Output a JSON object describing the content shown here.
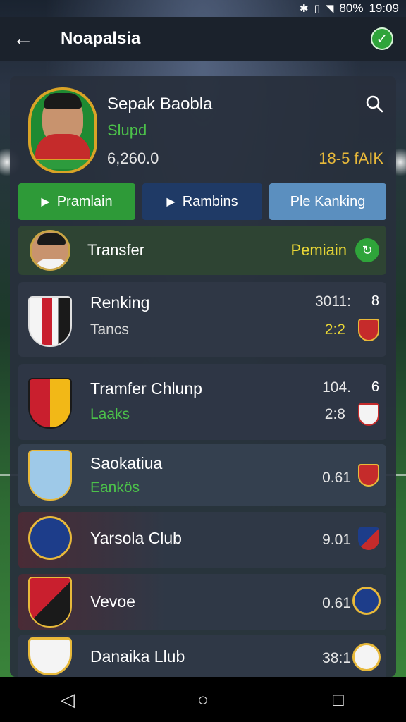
{
  "status_bar": {
    "icons": [
      "bluetooth-icon",
      "vibrate-icon",
      "wifi-icon"
    ],
    "battery": "80%",
    "time": "19:09"
  },
  "app_bar": {
    "title": "Noapalsia"
  },
  "profile": {
    "name": "Sepak Baobla",
    "club": "Slupd",
    "points": "6,260.0",
    "rank": "18-5 fAIK"
  },
  "tabs": [
    {
      "label": "Pramlain",
      "icon": "play-icon",
      "color": "#2e9a38"
    },
    {
      "label": "Rambins",
      "icon": "play-icon",
      "color": "#1f3a66"
    },
    {
      "label": "Ple Kanking",
      "icon": "",
      "color": "#5b8fbf"
    }
  ],
  "transfer": {
    "label": "Transfer",
    "status": "Pemiain"
  },
  "clubs": [
    {
      "name": "Renking",
      "sub": "Tancs",
      "score": "3011:",
      "right": "8",
      "score2": "2:2"
    },
    {
      "name": "Tramfer Chlunp",
      "sub": "Laaks",
      "score": "104.",
      "right": "6",
      "score2": "2:8"
    },
    {
      "name": "Saokatiua",
      "sub": "Eankös",
      "score": "0.61",
      "right": "",
      "score2": ""
    },
    {
      "name": "Yarsola Club",
      "sub": "",
      "score": "9.01",
      "right": "",
      "score2": ""
    },
    {
      "name": "Vevoe",
      "sub": "",
      "score": "0.61",
      "right": "",
      "score2": ""
    },
    {
      "name": "Danaika Llub",
      "sub": "",
      "score": "38:1",
      "right": "",
      "score2": ""
    }
  ]
}
